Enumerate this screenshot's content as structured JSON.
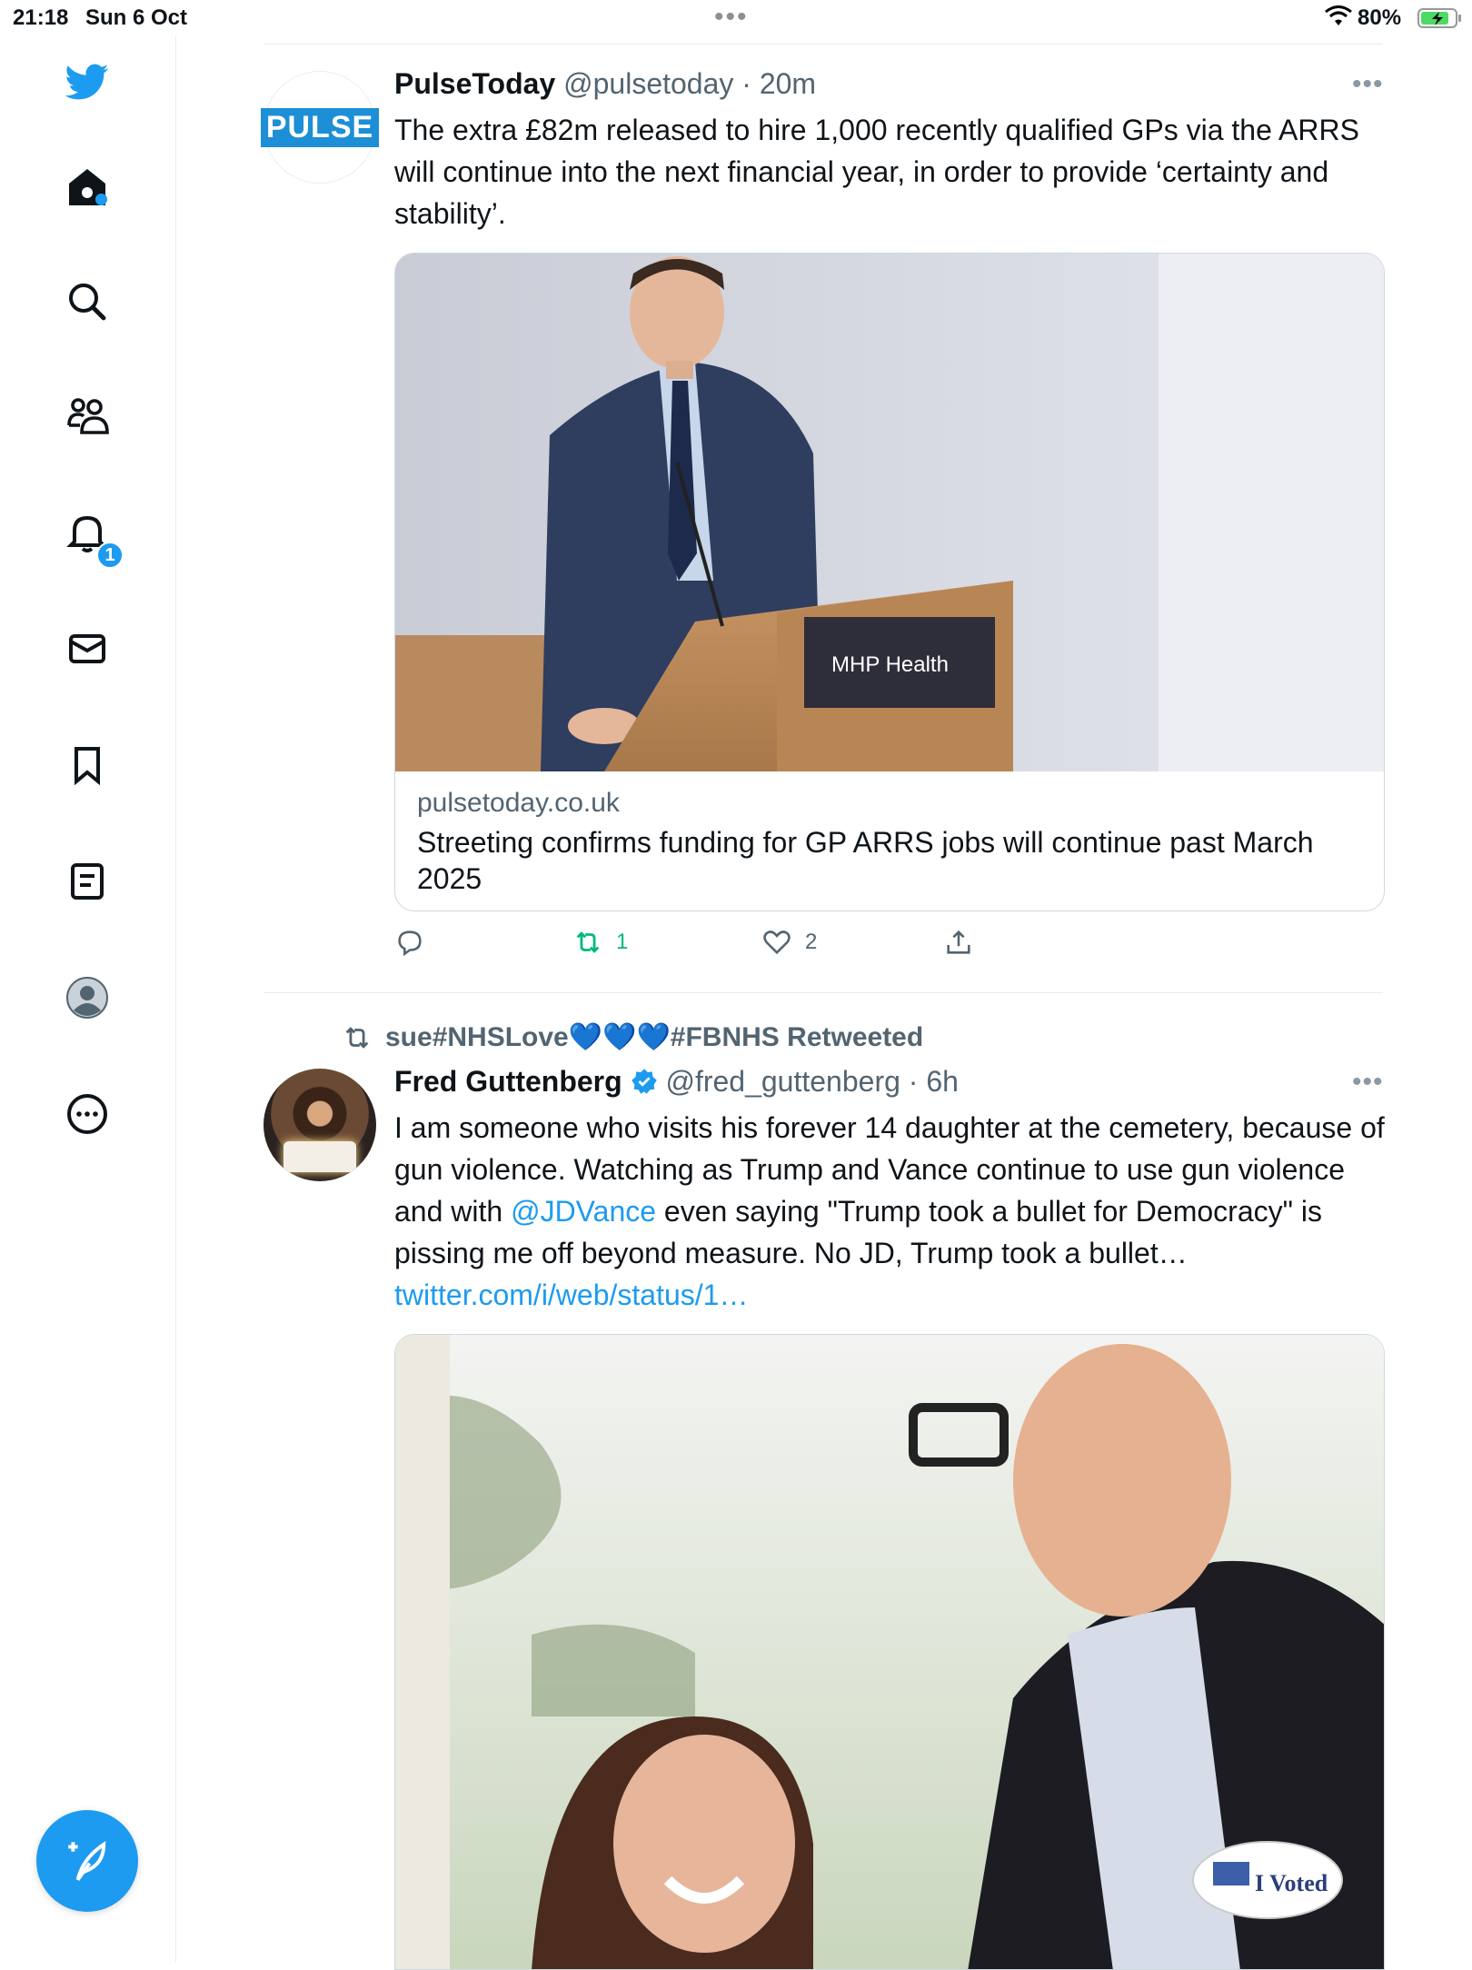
{
  "status_bar": {
    "time": "21:18",
    "date": "Sun 6 Oct",
    "battery": "80%",
    "accent": "#4cd964"
  },
  "sidebar": {
    "items": [
      {
        "name": "twitter-logo",
        "icon": "twitter-bird-icon"
      },
      {
        "name": "home",
        "icon": "home-icon"
      },
      {
        "name": "explore",
        "icon": "search-icon"
      },
      {
        "name": "communities",
        "icon": "communities-icon"
      },
      {
        "name": "notifications",
        "icon": "bell-icon",
        "badge": "1"
      },
      {
        "name": "messages",
        "icon": "mail-icon"
      },
      {
        "name": "bookmarks",
        "icon": "bookmark-icon"
      },
      {
        "name": "lists",
        "icon": "list-icon"
      },
      {
        "name": "profile",
        "icon": "profile-icon"
      },
      {
        "name": "more",
        "icon": "more-icon"
      }
    ],
    "compose_icon": "compose-icon"
  },
  "tweets": [
    {
      "name": "PulseToday",
      "handle": "@pulsetoday",
      "time": "20m",
      "avatar_text": "PULSE",
      "text": "The extra £82m released to hire 1,000 recently qualified GPs via the ARRS will continue into the next financial year, in order to provide ‘certainty and stability’.",
      "card": {
        "domain": "pulsetoday.co.uk",
        "title": "Streeting confirms funding for GP ARRS jobs will continue past March 2025",
        "image_sign": "MHP Health"
      },
      "actions": {
        "reply": "",
        "retweet": "1",
        "like": "2"
      }
    },
    {
      "retweeted_by": "sue#NHSLove💙💙💙#FBNHS Retweeted",
      "name": "Fred Guttenberg",
      "handle": "@fred_guttenberg",
      "time": "6h",
      "text_before": "I am someone who visits his forever 14 daughter at the cemetery, because of gun violence.  Watching as Trump and Vance continue to use gun violence and with ",
      "mention": "@JDVance",
      "text_after": " even saying \"Trump took a bullet for Democracy\" is pissing me off beyond measure.  No JD, Trump took a bullet… ",
      "link": "twitter.com/i/web/status/1…",
      "image_sticker": "I Voted"
    }
  ],
  "colors": {
    "accent": "#1d9bf0",
    "retweet": "#00ba7c",
    "muted": "#536471"
  }
}
